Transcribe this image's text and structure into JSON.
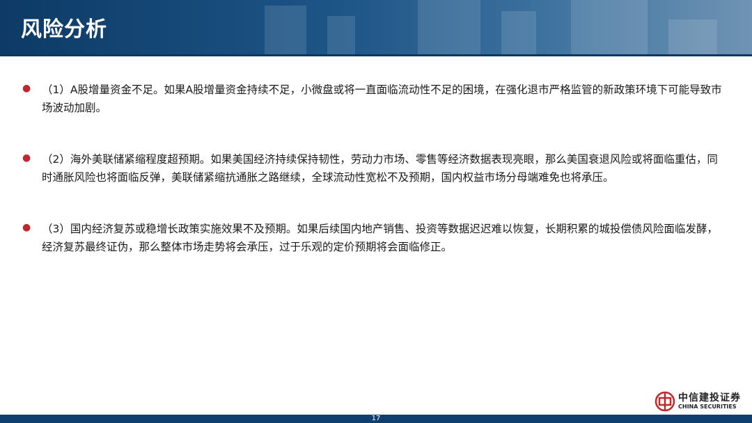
{
  "header": {
    "title": "风险分析"
  },
  "items": [
    {
      "text": "（1）A股增量资金不足。如果A股增量资金持续不足，小微盘或将一直面临流动性不足的困境，在强化退市严格监管的新政策环境下可能导致市场波动加剧。"
    },
    {
      "text": "（2）海外美联储紧缩程度超预期。如果美国经济持续保持韧性，劳动力市场、零售等经济数据表现亮眼，那么美国衰退风险或将面临重估，同时通胀风险也将面临反弹，美联储紧缩抗通胀之路继续，全球流动性宽松不及预期，国内权益市场分母端难免也将承压。"
    },
    {
      "text": "（3）国内经济复苏或稳增长政策实施效果不及预期。如果后续国内地产销售、投资等数据迟迟难以恢复，长期积累的城投偿债风险面临发酵，经济复苏最终证伪，那么整体市场走势将会承压，过于乐观的定价预期将会面临修正。"
    }
  ],
  "logo": {
    "cn": "中信建投证券",
    "en": "CHINA SECURITIES"
  },
  "footer": {
    "page": "17"
  },
  "colors": {
    "header": "#1d5587",
    "bullet": "#c0282d",
    "footer": "#0e3f6e"
  }
}
